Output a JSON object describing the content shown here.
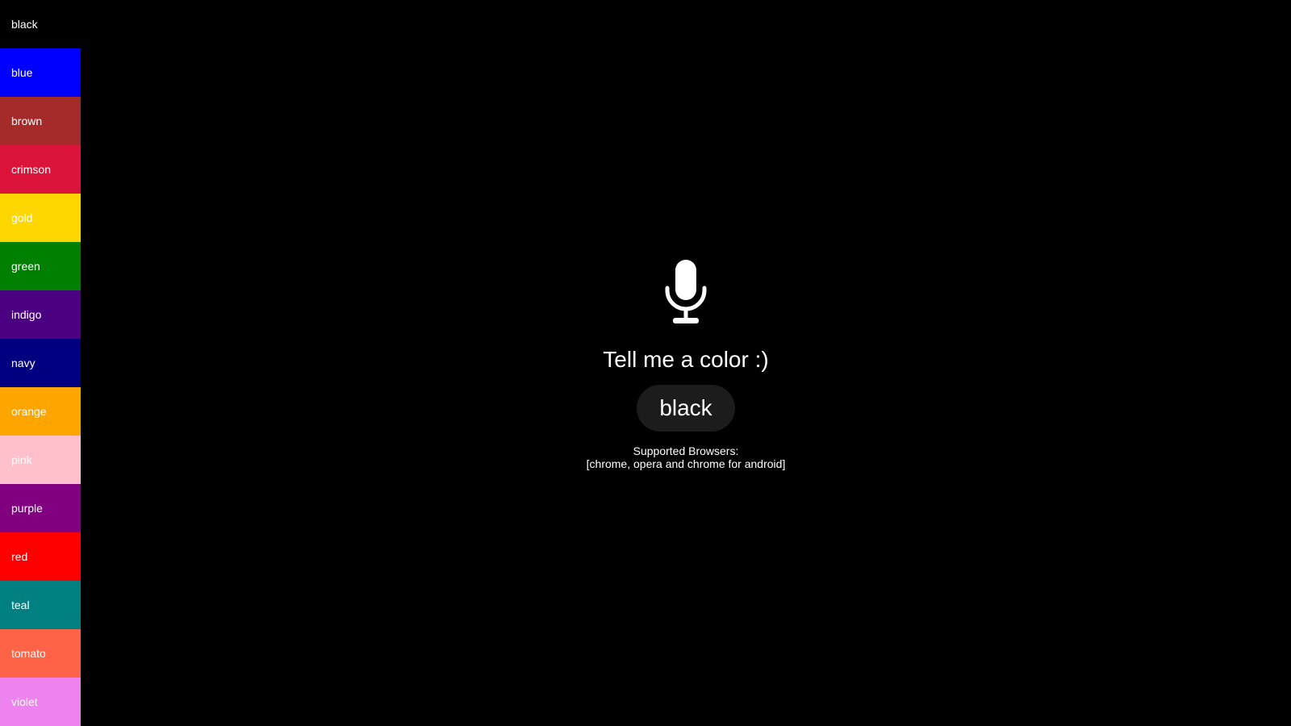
{
  "sidebar": {
    "colors": [
      {
        "name": "black",
        "hex": "#000000"
      },
      {
        "name": "blue",
        "hex": "#0000ff"
      },
      {
        "name": "brown",
        "hex": "#a52a2a"
      },
      {
        "name": "crimson",
        "hex": "#dc143c"
      },
      {
        "name": "gold",
        "hex": "#ffd700"
      },
      {
        "name": "green",
        "hex": "#008000"
      },
      {
        "name": "indigo",
        "hex": "#4b0082"
      },
      {
        "name": "navy",
        "hex": "#000080"
      },
      {
        "name": "orange",
        "hex": "#ffa500"
      },
      {
        "name": "pink",
        "hex": "#ffc0cb"
      },
      {
        "name": "purple",
        "hex": "#800080"
      },
      {
        "name": "red",
        "hex": "#ff0000"
      },
      {
        "name": "teal",
        "hex": "#008080"
      },
      {
        "name": "tomato",
        "hex": "#ff6347"
      },
      {
        "name": "violet",
        "hex": "#ee82ee"
      }
    ]
  },
  "main": {
    "mic_icon": "microphone-icon",
    "prompt": "Tell me a color :)",
    "result": "black",
    "support_line1": "Supported Browsers:",
    "support_line2": "[chrome, opera and chrome for android]"
  }
}
